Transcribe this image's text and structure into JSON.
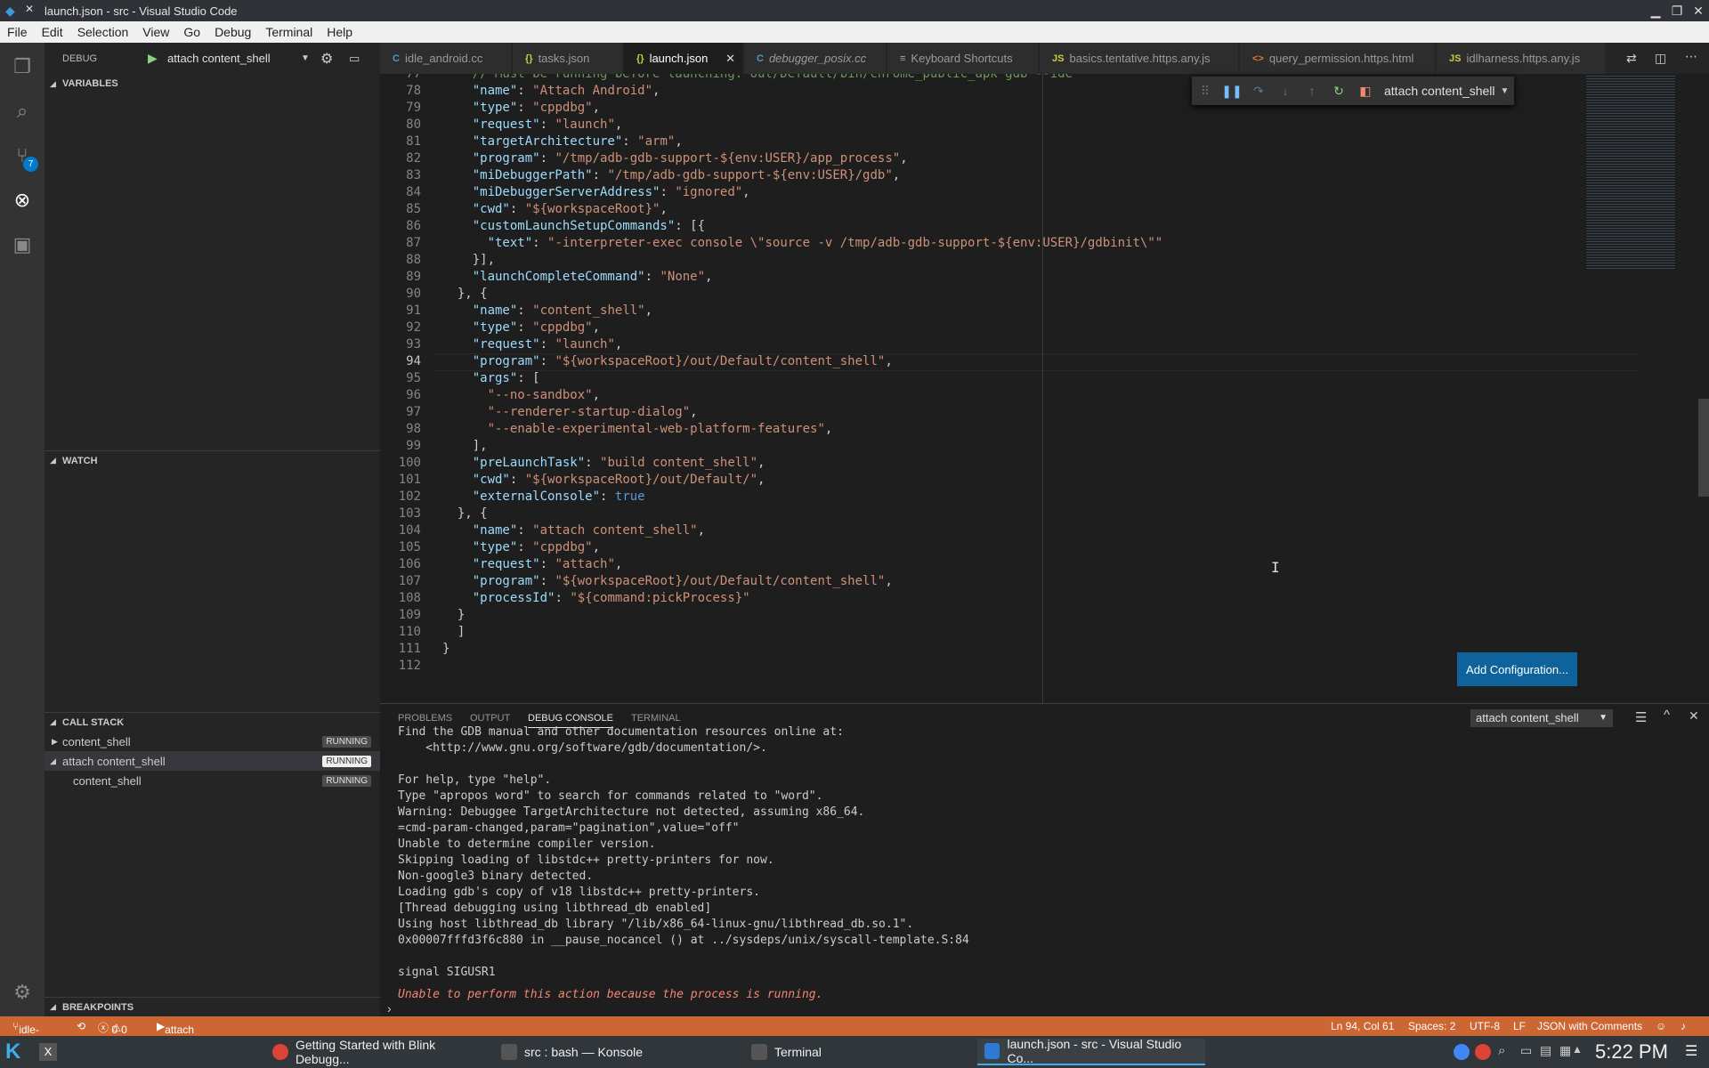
{
  "window": {
    "title": "launch.json - src - Visual Studio Code"
  },
  "menu": [
    "File",
    "Edit",
    "Selection",
    "View",
    "Go",
    "Debug",
    "Terminal",
    "Help"
  ],
  "activity": {
    "scm_badge": "7"
  },
  "sidebar": {
    "debug_label": "DEBUG",
    "config": "attach content_shell",
    "variables": "VARIABLES",
    "watch": "WATCH",
    "callstack": "CALL STACK",
    "breakpoints": "BREAKPOINTS",
    "stack": [
      {
        "label": "content_shell",
        "status": "RUNNING"
      },
      {
        "label": "attach content_shell",
        "status": "RUNNING"
      },
      {
        "label": "content_shell",
        "status": "RUNNING"
      }
    ]
  },
  "tabs": [
    {
      "icon": "C",
      "label": "idle_android.cc"
    },
    {
      "icon": "{}",
      "label": "tasks.json"
    },
    {
      "icon": "{}",
      "label": "launch.json"
    },
    {
      "icon": "C",
      "label": "debugger_posix.cc"
    },
    {
      "icon": "≡",
      "label": "Keyboard Shortcuts"
    },
    {
      "icon": "JS",
      "label": "basics.tentative.https.any.js"
    },
    {
      "icon": "<>",
      "label": "query_permission.https.html"
    },
    {
      "icon": "JS",
      "label": "idlharness.https.any.js"
    }
  ],
  "debug_toolbar": {
    "config": "attach content_shell"
  },
  "editor": {
    "lines": [
      {
        "n": "77",
        "t": "    // Must be running before launching: out/Default/bin/chrome_public_apk gdb --ide"
      },
      {
        "n": "78",
        "t": "    \"name\": \"Attach Android\","
      },
      {
        "n": "79",
        "t": "    \"type\": \"cppdbg\","
      },
      {
        "n": "80",
        "t": "    \"request\": \"launch\","
      },
      {
        "n": "81",
        "t": "    \"targetArchitecture\": \"arm\","
      },
      {
        "n": "82",
        "t": "    \"program\": \"/tmp/adb-gdb-support-${env:USER}/app_process\","
      },
      {
        "n": "83",
        "t": "    \"miDebuggerPath\": \"/tmp/adb-gdb-support-${env:USER}/gdb\","
      },
      {
        "n": "84",
        "t": "    \"miDebuggerServerAddress\": \"ignored\","
      },
      {
        "n": "85",
        "t": "    \"cwd\": \"${workspaceRoot}\","
      },
      {
        "n": "86",
        "t": "    \"customLaunchSetupCommands\": [{"
      },
      {
        "n": "87",
        "t": "      \"text\": \"-interpreter-exec console \\\"source -v /tmp/adb-gdb-support-${env:USER}/gdbinit\\\"\""
      },
      {
        "n": "88",
        "t": "    }],"
      },
      {
        "n": "89",
        "t": "    \"launchCompleteCommand\": \"None\","
      },
      {
        "n": "90",
        "t": "  }, {"
      },
      {
        "n": "91",
        "t": "    \"name\": \"content_shell\","
      },
      {
        "n": "92",
        "t": "    \"type\": \"cppdbg\","
      },
      {
        "n": "93",
        "t": "    \"request\": \"launch\","
      },
      {
        "n": "94",
        "t": "    \"program\": \"${workspaceRoot}/out/Default/content_shell\","
      },
      {
        "n": "95",
        "t": "    \"args\": ["
      },
      {
        "n": "96",
        "t": "      \"--no-sandbox\","
      },
      {
        "n": "97",
        "t": "      \"--renderer-startup-dialog\","
      },
      {
        "n": "98",
        "t": "      \"--enable-experimental-web-platform-features\","
      },
      {
        "n": "99",
        "t": "    ],"
      },
      {
        "n": "100",
        "t": "    \"preLaunchTask\": \"build content_shell\","
      },
      {
        "n": "101",
        "t": "    \"cwd\": \"${workspaceRoot}/out/Default/\","
      },
      {
        "n": "102",
        "t": "    \"externalConsole\": true"
      },
      {
        "n": "103",
        "t": "  }, {"
      },
      {
        "n": "104",
        "t": "    \"name\": \"attach content_shell\","
      },
      {
        "n": "105",
        "t": "    \"type\": \"cppdbg\","
      },
      {
        "n": "106",
        "t": "    \"request\": \"attach\","
      },
      {
        "n": "107",
        "t": "    \"program\": \"${workspaceRoot}/out/Default/content_shell\","
      },
      {
        "n": "108",
        "t": "    \"processId\": \"${command:pickProcess}\""
      },
      {
        "n": "109",
        "t": "  }"
      },
      {
        "n": "110",
        "t": "  ]"
      },
      {
        "n": "111",
        "t": "}"
      },
      {
        "n": "112",
        "t": ""
      }
    ],
    "add_config": "Add Configuration..."
  },
  "panel": {
    "tabs": [
      "PROBLEMS",
      "OUTPUT",
      "DEBUG CONSOLE",
      "TERMINAL"
    ],
    "config": "attach content_shell",
    "console": [
      "Find the GDB manual and other documentation resources online at:",
      "    <http://www.gnu.org/software/gdb/documentation/>.",
      "",
      "For help, type \"help\".",
      "Type \"apropos word\" to search for commands related to \"word\".",
      "Warning: Debuggee TargetArchitecture not detected, assuming x86_64.",
      "=cmd-param-changed,param=\"pagination\",value=\"off\"",
      "Unable to determine compiler version.",
      "Skipping loading of libstdc++ pretty-printers for now.",
      "Non-google3 binary detected.",
      "Loading gdb's copy of v18 libstdc++ pretty-printers.",
      "[Thread debugging using libthread_db enabled]",
      "Using host libthread_db library \"/lib/x86_64-linux-gnu/libthread_db.so.1\".",
      "0x00007fffd3f6c880 in __pause_nocancel () at ../sysdeps/unix/syscall-template.S:84",
      "",
      "signal SIGUSR1"
    ],
    "error": "Unable to perform this action because the process is running.",
    "prompt": "›"
  },
  "status": {
    "branch": "idle-api*",
    "errors": "0",
    "warnings": "0",
    "debug": "attach content_shell (src)",
    "position": "Ln 94, Col 61",
    "spaces": "Spaces: 2",
    "encoding": "UTF-8",
    "eol": "LF",
    "lang": "JSON with Comments"
  },
  "taskbar": {
    "items": [
      "Getting Started with Blink Debugg...",
      "src : bash — Konsole",
      "Terminal",
      "launch.json - src - Visual Studio Co..."
    ],
    "clock": "5:22 PM"
  }
}
